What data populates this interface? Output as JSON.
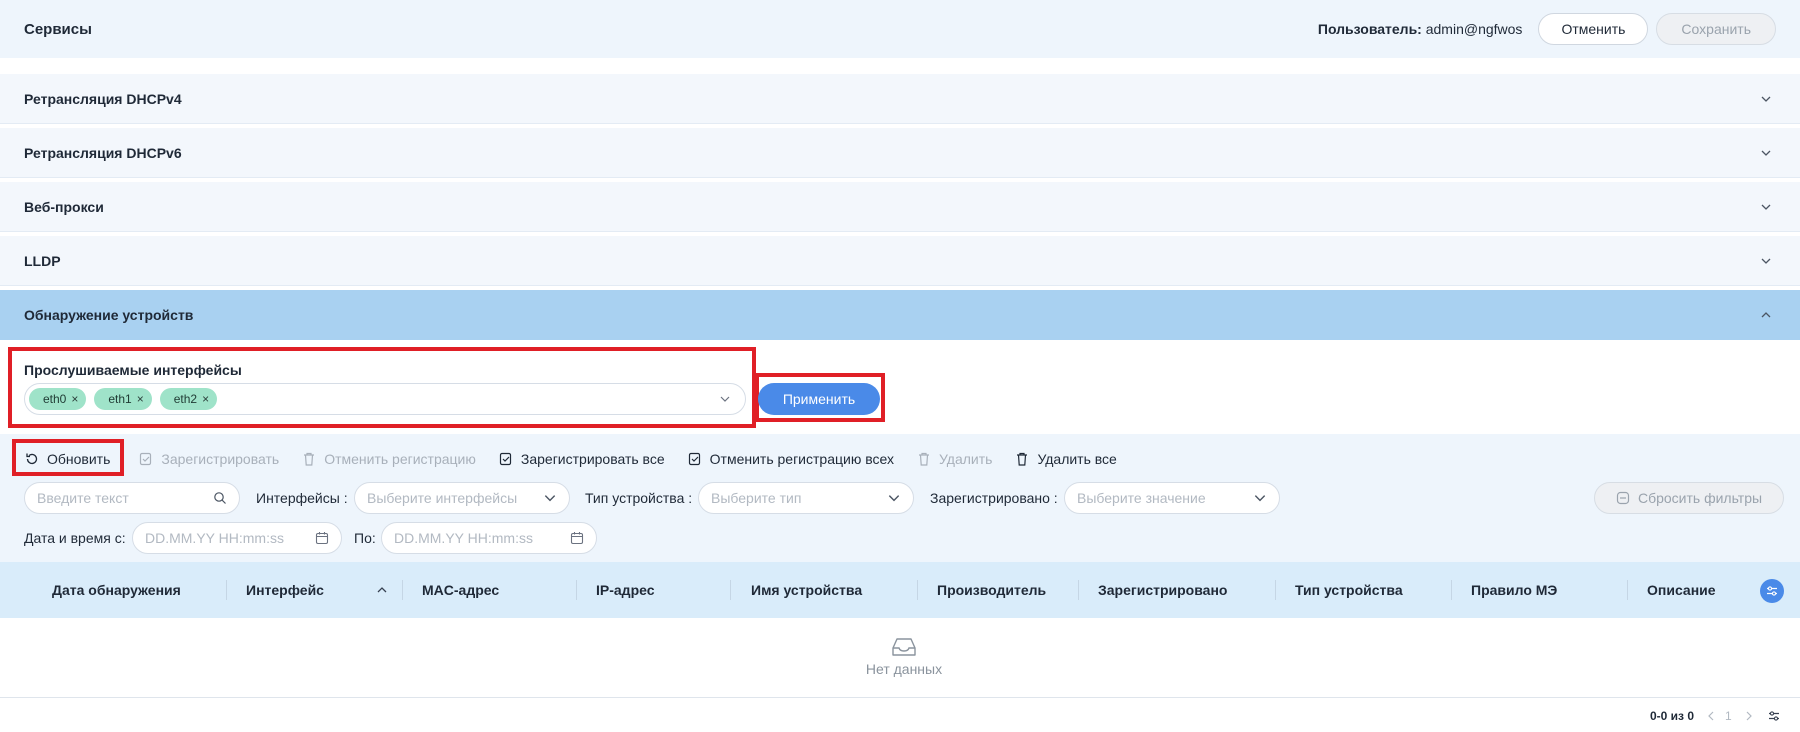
{
  "header": {
    "title": "Сервисы",
    "user_label": "Пользователь:",
    "user_value": "admin@ngfwos",
    "cancel_label": "Отменить",
    "save_label": "Сохранить"
  },
  "accordion": [
    {
      "label": "Ретрансляция DHCPv4",
      "expanded": false
    },
    {
      "label": "Ретрансляция DHCPv6",
      "expanded": false
    },
    {
      "label": "Веб-прокси",
      "expanded": false
    },
    {
      "label": "LLDP",
      "expanded": false
    },
    {
      "label": "Обнаружение устройств",
      "expanded": true
    }
  ],
  "listening": {
    "title": "Прослушиваемые интерфейсы",
    "tags": [
      "eth0",
      "eth1",
      "eth2"
    ],
    "apply_label": "Применить"
  },
  "toolbar": {
    "refresh": "Обновить",
    "register": "Зарегистрировать",
    "unregister": "Отменить регистрацию",
    "register_all": "Зарегистрировать все",
    "unregister_all": "Отменить регистрацию всех",
    "delete": "Удалить",
    "delete_all": "Удалить все"
  },
  "filters": {
    "search_placeholder": "Введите текст",
    "interfaces_label": "Интерфейсы :",
    "interfaces_placeholder": "Выберите интерфейсы",
    "device_type_label": "Тип устройства :",
    "device_type_placeholder": "Выберите тип",
    "registered_label": "Зарегистрировано :",
    "registered_placeholder": "Выберите значение",
    "reset_label": "Сбросить фильтры",
    "date_from_label": "Дата и время с:",
    "date_from_placeholder": "DD.MM.YY HH:mm:ss",
    "date_to_label": "По:",
    "date_to_placeholder": "DD.MM.YY HH:mm:ss"
  },
  "table": {
    "columns": [
      "Дата обнаружения",
      "Интерфейс",
      "MAC-адрес",
      "IP-адрес",
      "Имя устройства",
      "Производитель",
      "Зарегистрировано",
      "Тип устройства",
      "Правило МЭ",
      "Описание"
    ],
    "empty_text": "Нет данных"
  },
  "pagination": {
    "range": "0-0 из 0",
    "page": "1"
  },
  "colors": {
    "accent": "#4a8ae8",
    "highlight": "#e01f26",
    "tag": "#9fe3c9",
    "active_section": "#a9d1f1"
  }
}
